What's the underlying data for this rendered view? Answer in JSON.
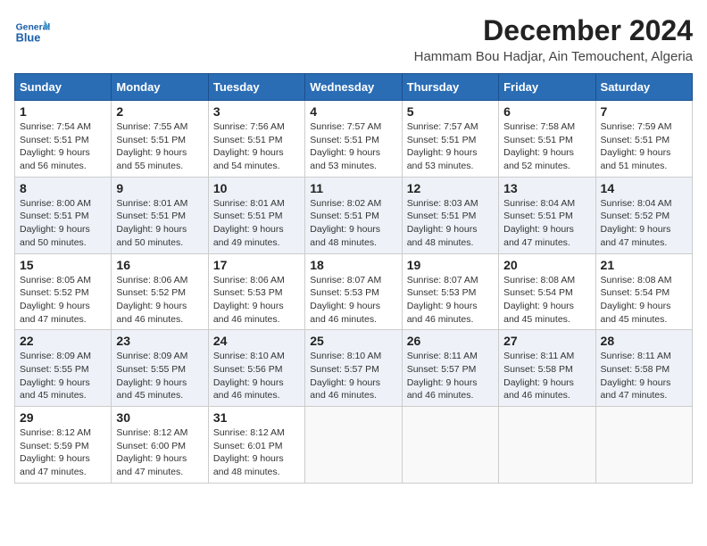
{
  "logo": {
    "general": "General",
    "blue": "Blue"
  },
  "title": "December 2024",
  "subtitle": "Hammam Bou Hadjar, Ain Temouchent, Algeria",
  "days_header": [
    "Sunday",
    "Monday",
    "Tuesday",
    "Wednesday",
    "Thursday",
    "Friday",
    "Saturday"
  ],
  "weeks": [
    [
      {
        "day": "1",
        "sunrise": "7:54 AM",
        "sunset": "5:51 PM",
        "daylight": "9 hours and 56 minutes."
      },
      {
        "day": "2",
        "sunrise": "7:55 AM",
        "sunset": "5:51 PM",
        "daylight": "9 hours and 55 minutes."
      },
      {
        "day": "3",
        "sunrise": "7:56 AM",
        "sunset": "5:51 PM",
        "daylight": "9 hours and 54 minutes."
      },
      {
        "day": "4",
        "sunrise": "7:57 AM",
        "sunset": "5:51 PM",
        "daylight": "9 hours and 53 minutes."
      },
      {
        "day": "5",
        "sunrise": "7:57 AM",
        "sunset": "5:51 PM",
        "daylight": "9 hours and 53 minutes."
      },
      {
        "day": "6",
        "sunrise": "7:58 AM",
        "sunset": "5:51 PM",
        "daylight": "9 hours and 52 minutes."
      },
      {
        "day": "7",
        "sunrise": "7:59 AM",
        "sunset": "5:51 PM",
        "daylight": "9 hours and 51 minutes."
      }
    ],
    [
      {
        "day": "8",
        "sunrise": "8:00 AM",
        "sunset": "5:51 PM",
        "daylight": "9 hours and 50 minutes."
      },
      {
        "day": "9",
        "sunrise": "8:01 AM",
        "sunset": "5:51 PM",
        "daylight": "9 hours and 50 minutes."
      },
      {
        "day": "10",
        "sunrise": "8:01 AM",
        "sunset": "5:51 PM",
        "daylight": "9 hours and 49 minutes."
      },
      {
        "day": "11",
        "sunrise": "8:02 AM",
        "sunset": "5:51 PM",
        "daylight": "9 hours and 48 minutes."
      },
      {
        "day": "12",
        "sunrise": "8:03 AM",
        "sunset": "5:51 PM",
        "daylight": "9 hours and 48 minutes."
      },
      {
        "day": "13",
        "sunrise": "8:04 AM",
        "sunset": "5:51 PM",
        "daylight": "9 hours and 47 minutes."
      },
      {
        "day": "14",
        "sunrise": "8:04 AM",
        "sunset": "5:52 PM",
        "daylight": "9 hours and 47 minutes."
      }
    ],
    [
      {
        "day": "15",
        "sunrise": "8:05 AM",
        "sunset": "5:52 PM",
        "daylight": "9 hours and 47 minutes."
      },
      {
        "day": "16",
        "sunrise": "8:06 AM",
        "sunset": "5:52 PM",
        "daylight": "9 hours and 46 minutes."
      },
      {
        "day": "17",
        "sunrise": "8:06 AM",
        "sunset": "5:53 PM",
        "daylight": "9 hours and 46 minutes."
      },
      {
        "day": "18",
        "sunrise": "8:07 AM",
        "sunset": "5:53 PM",
        "daylight": "9 hours and 46 minutes."
      },
      {
        "day": "19",
        "sunrise": "8:07 AM",
        "sunset": "5:53 PM",
        "daylight": "9 hours and 46 minutes."
      },
      {
        "day": "20",
        "sunrise": "8:08 AM",
        "sunset": "5:54 PM",
        "daylight": "9 hours and 45 minutes."
      },
      {
        "day": "21",
        "sunrise": "8:08 AM",
        "sunset": "5:54 PM",
        "daylight": "9 hours and 45 minutes."
      }
    ],
    [
      {
        "day": "22",
        "sunrise": "8:09 AM",
        "sunset": "5:55 PM",
        "daylight": "9 hours and 45 minutes."
      },
      {
        "day": "23",
        "sunrise": "8:09 AM",
        "sunset": "5:55 PM",
        "daylight": "9 hours and 45 minutes."
      },
      {
        "day": "24",
        "sunrise": "8:10 AM",
        "sunset": "5:56 PM",
        "daylight": "9 hours and 46 minutes."
      },
      {
        "day": "25",
        "sunrise": "8:10 AM",
        "sunset": "5:57 PM",
        "daylight": "9 hours and 46 minutes."
      },
      {
        "day": "26",
        "sunrise": "8:11 AM",
        "sunset": "5:57 PM",
        "daylight": "9 hours and 46 minutes."
      },
      {
        "day": "27",
        "sunrise": "8:11 AM",
        "sunset": "5:58 PM",
        "daylight": "9 hours and 46 minutes."
      },
      {
        "day": "28",
        "sunrise": "8:11 AM",
        "sunset": "5:58 PM",
        "daylight": "9 hours and 47 minutes."
      }
    ],
    [
      {
        "day": "29",
        "sunrise": "8:12 AM",
        "sunset": "5:59 PM",
        "daylight": "9 hours and 47 minutes."
      },
      {
        "day": "30",
        "sunrise": "8:12 AM",
        "sunset": "6:00 PM",
        "daylight": "9 hours and 47 minutes."
      },
      {
        "day": "31",
        "sunrise": "8:12 AM",
        "sunset": "6:01 PM",
        "daylight": "9 hours and 48 minutes."
      },
      null,
      null,
      null,
      null
    ]
  ],
  "labels": {
    "sunrise": "Sunrise:",
    "sunset": "Sunset:",
    "daylight": "Daylight:"
  }
}
